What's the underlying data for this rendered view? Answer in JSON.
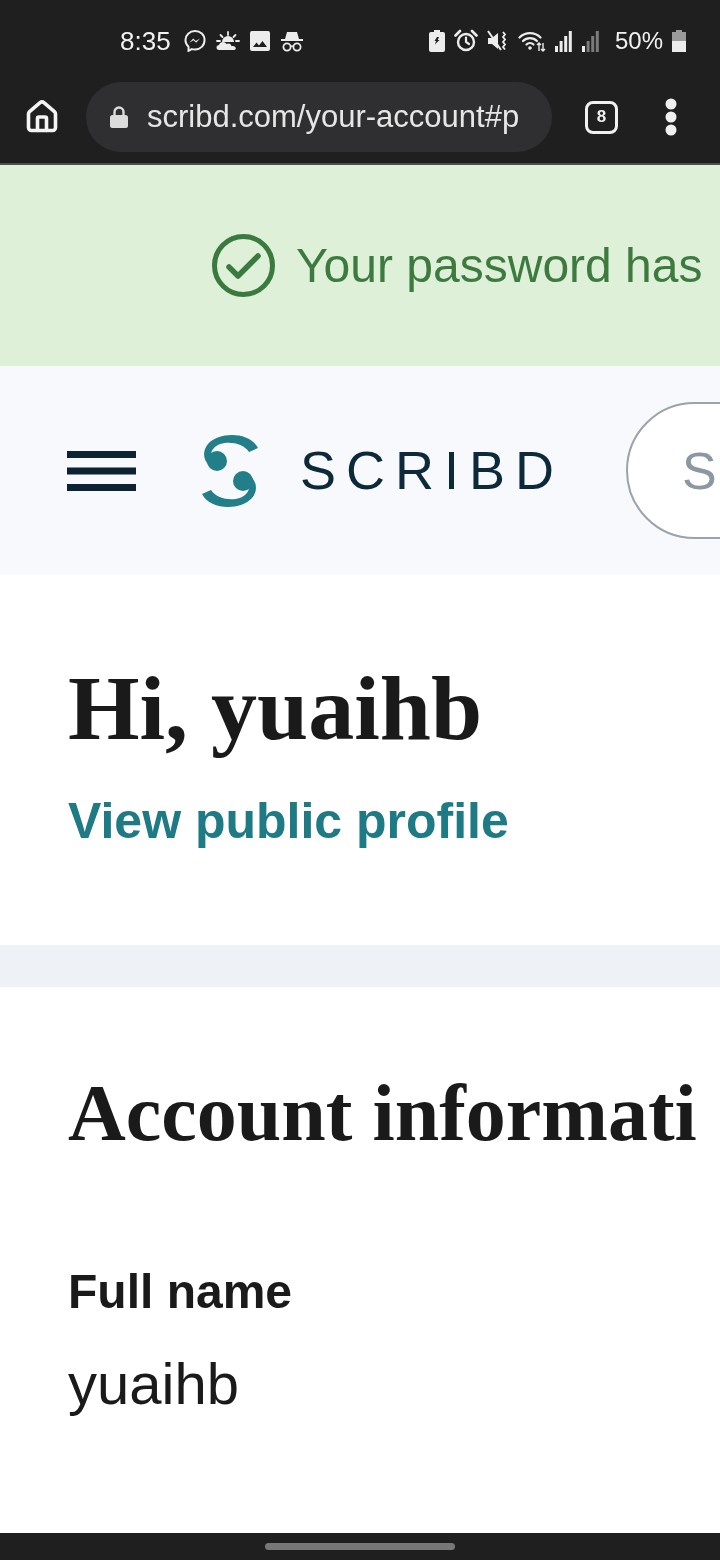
{
  "status_bar": {
    "time": "8:35",
    "battery": "50%"
  },
  "browser": {
    "url": "scribd.com/your-account#p",
    "tab_count": "8"
  },
  "banner": {
    "message": "Your password has"
  },
  "header": {
    "logo_text": "SCRIBD",
    "search": {
      "placeholder": "S"
    }
  },
  "greeting": {
    "title": "Hi, yuaihb",
    "link": "View public profile"
  },
  "account": {
    "title": "Account informati",
    "fields": [
      {
        "label": "Full name",
        "value": "yuaihb"
      }
    ]
  }
}
